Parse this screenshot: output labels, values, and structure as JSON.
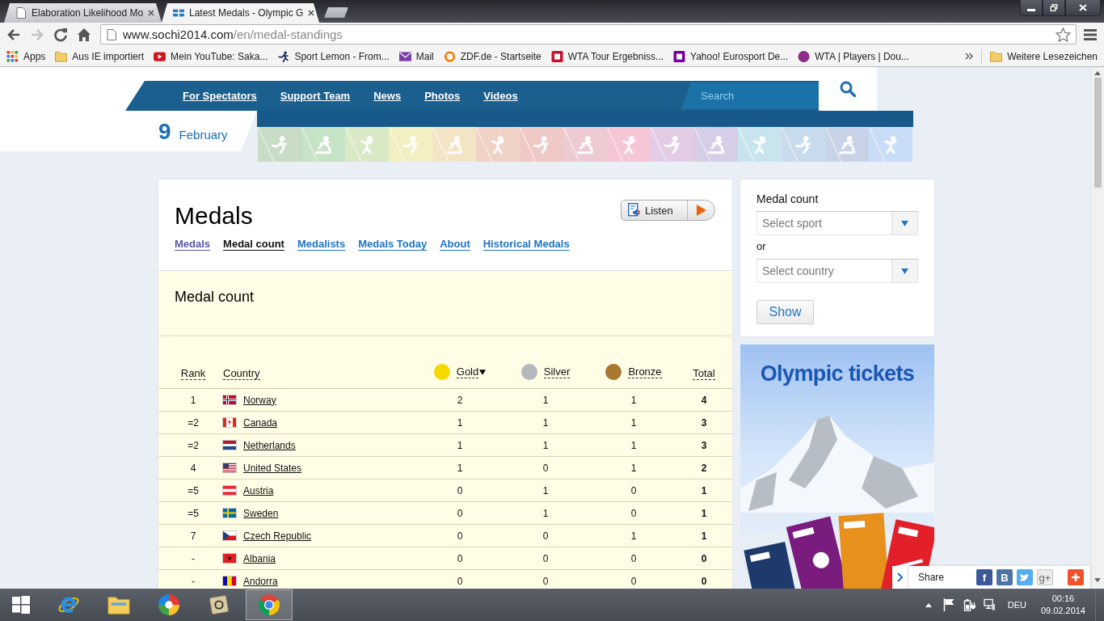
{
  "browser": {
    "tabs": [
      {
        "kind": "document",
        "title": "Elaboration Likelihood Mo",
        "selected": false
      },
      {
        "kind": "site",
        "title": "Latest Medals - Olympic G",
        "selected": true
      }
    ],
    "toolbar": {
      "back_disabled": false,
      "forward_disabled": true
    },
    "address": {
      "host": "www.sochi2014.com",
      "path": "/en/medal-standings"
    },
    "bookmarks": [
      {
        "kind": "apps",
        "label": "Apps"
      },
      {
        "kind": "folder",
        "label": "Aus IE importiert"
      },
      {
        "kind": "play",
        "label": "Mein YouTube: Saka...",
        "color": "#cc181e"
      },
      {
        "kind": "runner",
        "label": "Sport Lemon - From...",
        "color": "#1b2a5e"
      },
      {
        "kind": "envelope",
        "label": "Mail",
        "color": "#7b3fa8"
      },
      {
        "kind": "ring",
        "label": "ZDF.de - Startseite",
        "color": "#f07d00"
      },
      {
        "kind": "square",
        "label": "WTA Tour Ergebniss...",
        "color": "#c8102e"
      },
      {
        "kind": "square",
        "label": "Yahoo! Eurosport De...",
        "color": "#7b0099"
      },
      {
        "kind": "disc",
        "label": "WTA | Players | Dou...",
        "color": "#8e2a8a"
      }
    ],
    "other_bookmarks": {
      "label": "Weitere Lesezeichen"
    }
  },
  "site_header": {
    "nav": [
      "For Spectators",
      "Support Team",
      "News",
      "Photos",
      "Videos"
    ],
    "search": {
      "placeholder": "Search"
    },
    "date": {
      "day": "9",
      "month": "February"
    },
    "sport_tiles": [
      {
        "color": "#c9dcc6"
      },
      {
        "color": "#c6e3c6"
      },
      {
        "color": "#d9e9c6"
      },
      {
        "color": "#f3efc3"
      },
      {
        "color": "#f4e4c6"
      },
      {
        "color": "#f0d3c6"
      },
      {
        "color": "#efc9c6"
      },
      {
        "color": "#eecbd3"
      },
      {
        "color": "#f6c5d6"
      },
      {
        "color": "#e2cde5"
      },
      {
        "color": "#d6cde6"
      },
      {
        "color": "#c8e5ee"
      },
      {
        "color": "#c8dbec"
      },
      {
        "color": "#c9d3e8"
      },
      {
        "color": "#c9ddf8"
      }
    ]
  },
  "medals_panel": {
    "title": "Medals",
    "listen": "Listen",
    "tabs": [
      {
        "label": "Medals",
        "selected": false,
        "visited": true
      },
      {
        "label": "Medal count",
        "selected": true,
        "visited": false
      },
      {
        "label": "Medalists",
        "selected": false,
        "visited": false
      },
      {
        "label": "Medals Today",
        "selected": false,
        "visited": false
      },
      {
        "label": "About",
        "selected": false,
        "visited": false
      },
      {
        "label": "Historical Medals",
        "selected": false,
        "visited": false
      }
    ],
    "section_title": "Medal count",
    "columns": [
      {
        "kind": "rank",
        "label": "Rank"
      },
      {
        "kind": "country",
        "label": "Country"
      },
      {
        "kind": "medal",
        "label": "Gold",
        "color": "#f5d800",
        "sorted": true
      },
      {
        "kind": "medal",
        "label": "Silver",
        "color": "#b4b7bd",
        "sorted": false
      },
      {
        "kind": "medal",
        "label": "Bronze",
        "color": "#a9772f",
        "sorted": false
      },
      {
        "kind": "total",
        "label": "Total"
      }
    ],
    "rows": [
      {
        "rank": "1",
        "country": "Norway",
        "gold": "2",
        "silver": "1",
        "bronze": "1",
        "total": "4"
      },
      {
        "rank": "=2",
        "country": "Canada",
        "gold": "1",
        "silver": "1",
        "bronze": "1",
        "total": "3"
      },
      {
        "rank": "=2",
        "country": "Netherlands",
        "gold": "1",
        "silver": "1",
        "bronze": "1",
        "total": "3"
      },
      {
        "rank": "4",
        "country": "United States",
        "gold": "1",
        "silver": "0",
        "bronze": "1",
        "total": "2"
      },
      {
        "rank": "=5",
        "country": "Austria",
        "gold": "0",
        "silver": "1",
        "bronze": "0",
        "total": "1"
      },
      {
        "rank": "=5",
        "country": "Sweden",
        "gold": "0",
        "silver": "1",
        "bronze": "0",
        "total": "1"
      },
      {
        "rank": "7",
        "country": "Czech Republic",
        "gold": "0",
        "silver": "0",
        "bronze": "1",
        "total": "1"
      },
      {
        "rank": "-",
        "country": "Albania",
        "gold": "0",
        "silver": "0",
        "bronze": "0",
        "total": "0"
      },
      {
        "rank": "-",
        "country": "Andorra",
        "gold": "0",
        "silver": "0",
        "bronze": "0",
        "total": "0"
      }
    ]
  },
  "sidebar": {
    "title": "Medal count",
    "sport_select": {
      "placeholder": "Select sport"
    },
    "or_text": "or",
    "country_select": {
      "placeholder": "Select country"
    },
    "button": "Show"
  },
  "ad": {
    "title": "Olympic tickets"
  },
  "share_bar": {
    "label": "Share",
    "buttons": [
      {
        "kind": "letter",
        "glyph": "f",
        "color": "#3b5998"
      },
      {
        "kind": "letter",
        "glyph": "B",
        "color": "#4c75a3"
      },
      {
        "kind": "bird",
        "color": "#55acee"
      },
      {
        "kind": "letter",
        "glyph": "g+",
        "color": "#ececec"
      },
      {
        "kind": "plus",
        "color": "#f0522a"
      }
    ]
  },
  "taskbar": {
    "apps": [
      {
        "kind": "e-logo",
        "selected": false
      },
      {
        "kind": "folder",
        "selected": false
      },
      {
        "kind": "wheel",
        "selected": false
      },
      {
        "kind": "card",
        "selected": false
      },
      {
        "kind": "chrome",
        "selected": true
      }
    ],
    "language": "DEU",
    "time": "00:16",
    "date": "09.02.2014"
  }
}
